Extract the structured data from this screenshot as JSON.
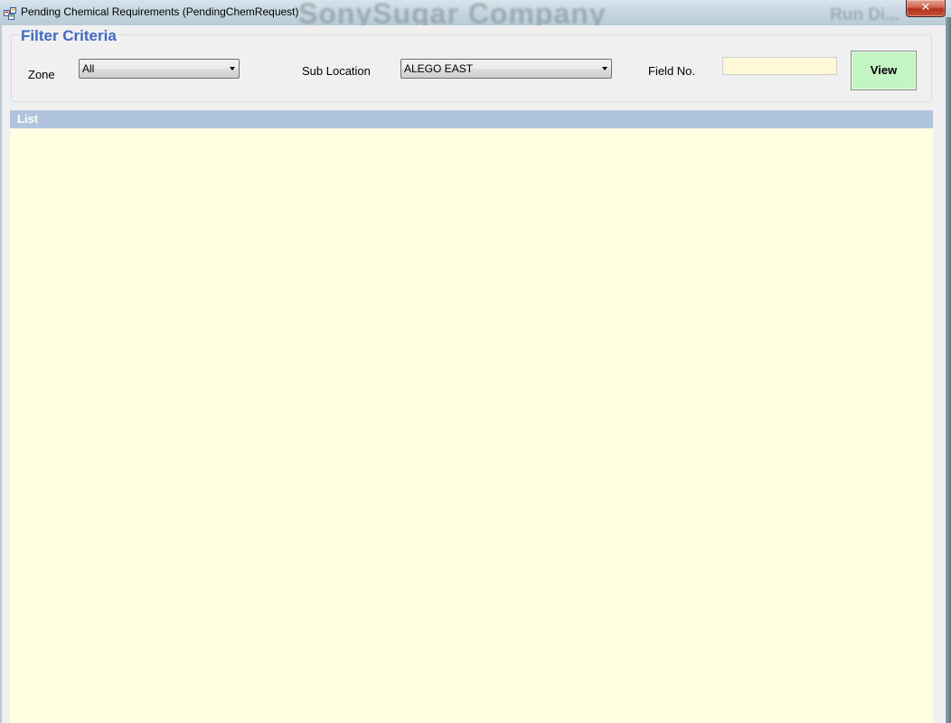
{
  "window": {
    "title": "Pending Chemical Requirements (PendingChemRequest)",
    "close_glyph": "✕",
    "background_text": "SonySugar Company",
    "background_text_right": "Run Di..."
  },
  "filter": {
    "group_title": "Filter Criteria",
    "zone_label": "Zone",
    "zone_value": "All",
    "sub_location_label": "Sub Location",
    "sub_location_value": "ALEGO EAST",
    "field_no_label": "Field No.",
    "field_no_value": "",
    "view_button": "View"
  },
  "list": {
    "header": "List",
    "rows": []
  },
  "colors": {
    "group_title": "#3e68c8",
    "list_header": "#b0c4de",
    "list_body": "#ffffe1",
    "view_button": "#c2f5c2",
    "field_input": "#fff8d6"
  }
}
